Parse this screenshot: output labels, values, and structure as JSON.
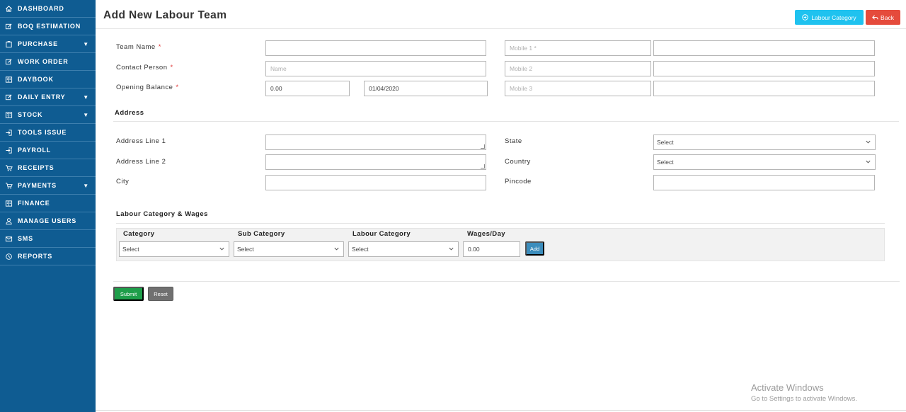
{
  "sidebar": {
    "items": [
      {
        "label": "DASHBOARD",
        "icon": "home-icon",
        "caret": false
      },
      {
        "label": "BOQ ESTIMATION",
        "icon": "edit-icon",
        "caret": false
      },
      {
        "label": "PURCHASE",
        "icon": "clipboard-icon",
        "caret": true
      },
      {
        "label": "WORK ORDER",
        "icon": "edit-icon",
        "caret": false
      },
      {
        "label": "DAYBOOK",
        "icon": "book-icon",
        "caret": false
      },
      {
        "label": "DAILY ENTRY",
        "icon": "edit-icon",
        "caret": true
      },
      {
        "label": "STOCK",
        "icon": "book-icon",
        "caret": true
      },
      {
        "label": "TOOLS ISSUE",
        "icon": "sign-in-icon",
        "caret": false
      },
      {
        "label": "PAYROLL",
        "icon": "sign-in-icon",
        "caret": false
      },
      {
        "label": "RECEIPTS",
        "icon": "cart-icon",
        "caret": false
      },
      {
        "label": "PAYMENTS",
        "icon": "cart-icon",
        "caret": true
      },
      {
        "label": "FINANCE",
        "icon": "book-icon",
        "caret": false
      },
      {
        "label": "MANAGE USERS",
        "icon": "user-icon",
        "caret": false
      },
      {
        "label": "SMS",
        "icon": "envelope-icon",
        "caret": false
      },
      {
        "label": "REPORTS",
        "icon": "history-icon",
        "caret": false
      }
    ],
    "caret_glyph": "▼"
  },
  "header": {
    "title": "Add New Labour Team",
    "labour_category_button": "Labour Category",
    "back_button": "Back",
    "accent_cyan": "#1fc2ef",
    "accent_red": "#e54b3c"
  },
  "form": {
    "team_name_label": "Team Name",
    "contact_person_label": "Contact Person",
    "opening_balance_label": "Opening Balance",
    "required_mark": "*",
    "team_name_value": "",
    "contact_person_placeholder": "Name",
    "opening_balance_value": "0.00",
    "opening_date_value": "01/04/2020",
    "mobile1_placeholder": "Mobile 1 *",
    "mobile2_placeholder": "Mobile 2",
    "mobile3_placeholder": "Mobile 3"
  },
  "address": {
    "section_title": "Address",
    "line1_label": "Address Line 1",
    "line2_label": "Address Line 2",
    "city_label": "City",
    "state_label": "State",
    "country_label": "Country",
    "pincode_label": "Pincode",
    "state_value": "Select",
    "country_value": "Select"
  },
  "wages": {
    "section_title": "Labour Category & Wages",
    "category_header": "Category",
    "sub_category_header": "Sub Category",
    "labour_category_header": "Labour Category",
    "wages_header": "Wages/Day",
    "category_value": "Select",
    "sub_category_value": "Select",
    "labour_category_value": "Select",
    "wages_value": "0.00",
    "add_button": "Add"
  },
  "actions": {
    "submit": "Submit",
    "reset": "Reset"
  },
  "watermark": {
    "title": "Activate Windows",
    "subtitle": "Go to Settings to activate Windows."
  }
}
